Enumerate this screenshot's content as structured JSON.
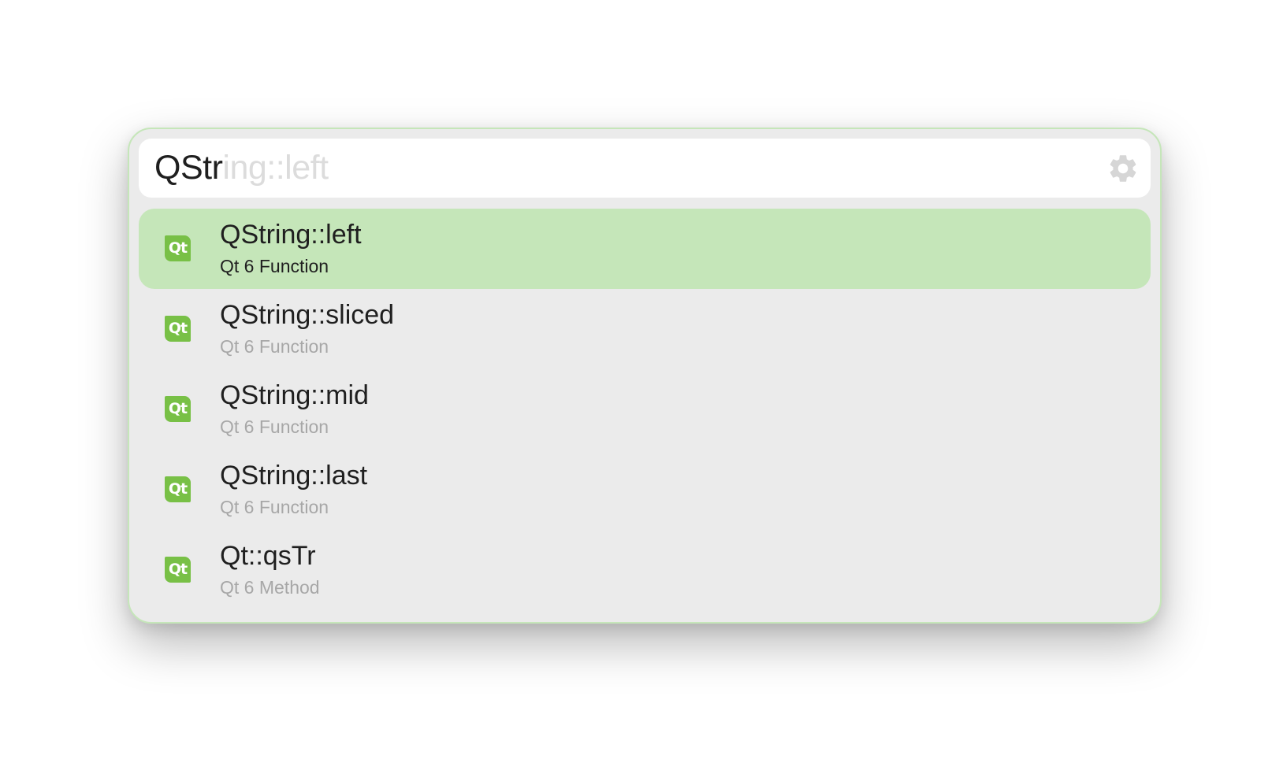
{
  "search": {
    "typed": "QStr",
    "autocomplete": "ing::left",
    "settings_icon": "gear-icon"
  },
  "results": [
    {
      "title": "QString::left",
      "subtitle": "Qt 6 Function",
      "icon_text": "Qt",
      "selected": true
    },
    {
      "title": "QString::sliced",
      "subtitle": "Qt 6 Function",
      "icon_text": "Qt",
      "selected": false
    },
    {
      "title": "QString::mid",
      "subtitle": "Qt 6 Function",
      "icon_text": "Qt",
      "selected": false
    },
    {
      "title": "QString::last",
      "subtitle": "Qt 6 Function",
      "icon_text": "Qt",
      "selected": false
    },
    {
      "title": "Qt::qsTr",
      "subtitle": "Qt 6 Method",
      "icon_text": "Qt",
      "selected": false
    }
  ],
  "colors": {
    "accent_border": "#c5e6b9",
    "selected_row": "#c5e6b9",
    "panel_background": "#ebebeb",
    "qt_logo": "#78c046"
  }
}
